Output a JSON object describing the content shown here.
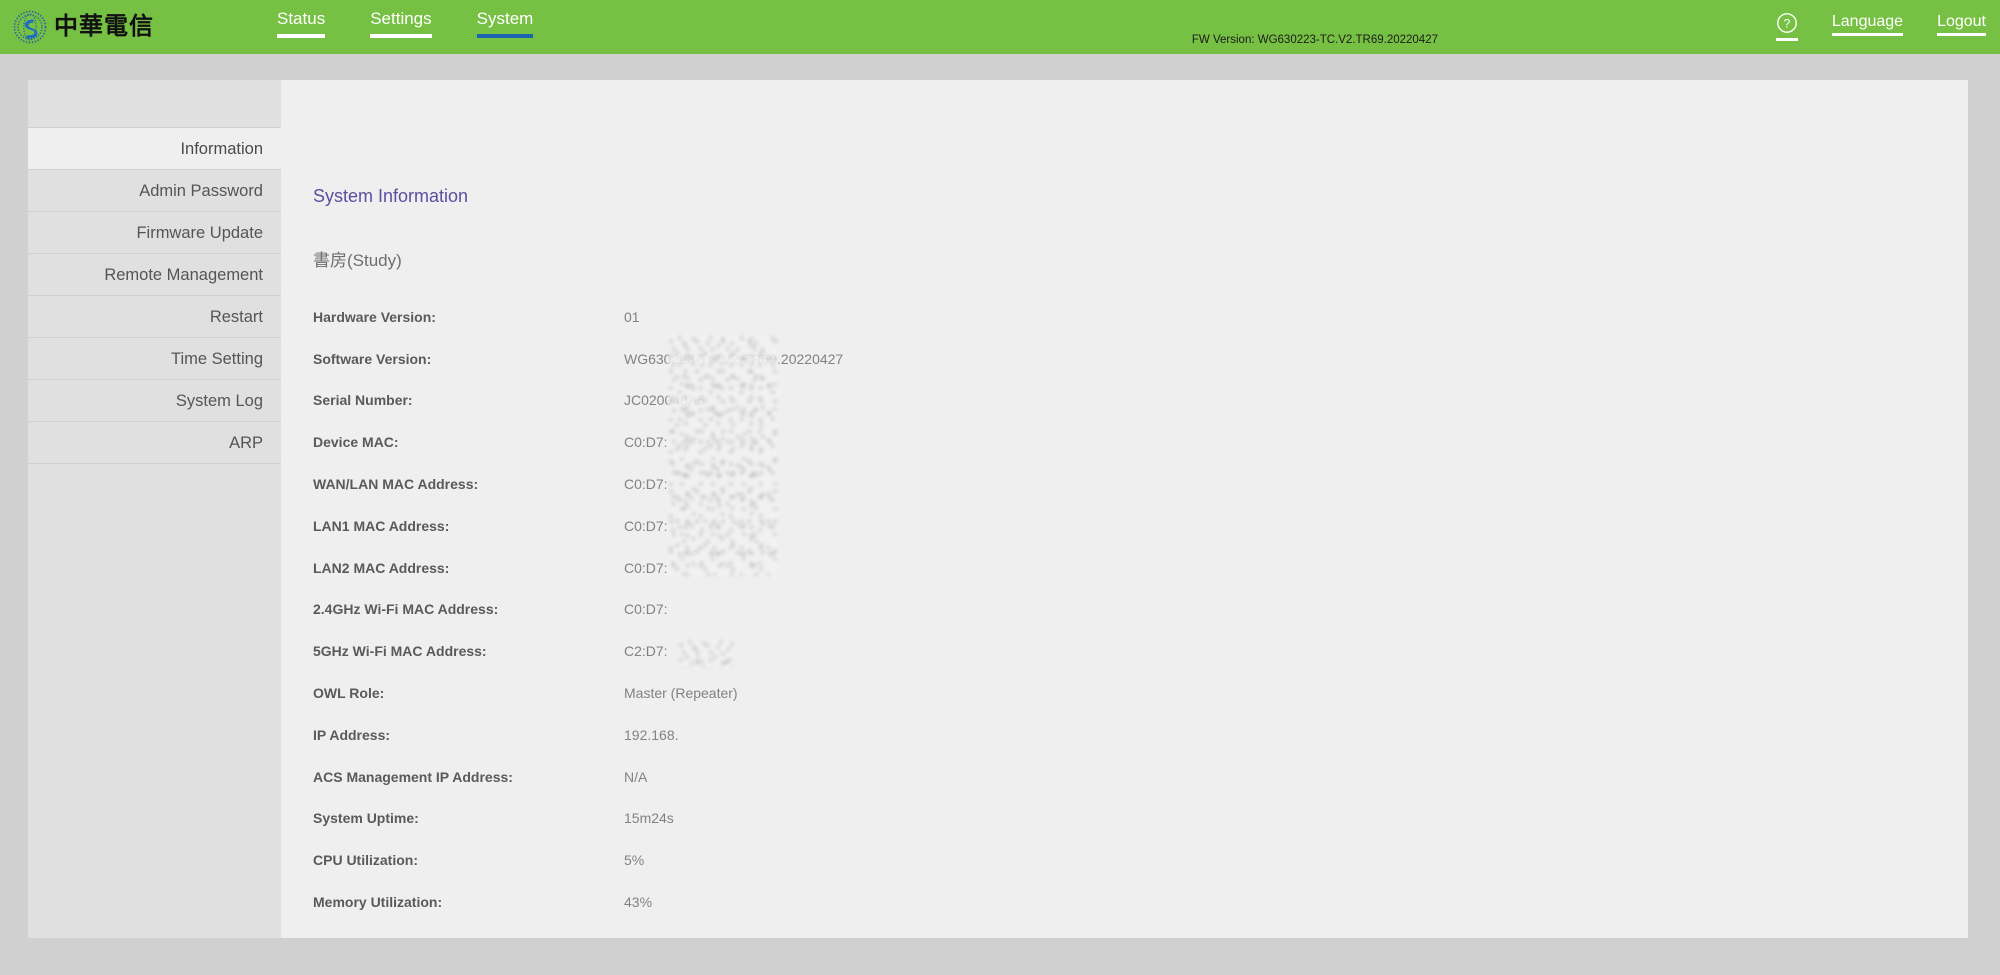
{
  "header": {
    "brand_name": "中華電信",
    "brand_logo_icon": "chunghwa-telecom-globe-logo",
    "nav_tabs": [
      {
        "label": "Status",
        "active": false
      },
      {
        "label": "Settings",
        "active": false
      },
      {
        "label": "System",
        "active": true
      }
    ],
    "fw_version": "FW Version: WG630223-TC.V2.TR69.20220427",
    "help_icon": "question-mark-circle-icon",
    "language_label": "Language",
    "logout_label": "Logout",
    "bar_color": "#76c043",
    "active_underline_color": "#1d64b0",
    "inactive_underline_color": "#ffffff"
  },
  "sidebar": {
    "items": [
      {
        "label": "Information",
        "active": true
      },
      {
        "label": "Admin Password",
        "active": false
      },
      {
        "label": "Firmware Update",
        "active": false
      },
      {
        "label": "Remote Management",
        "active": false
      },
      {
        "label": "Restart",
        "active": false
      },
      {
        "label": "Time Setting",
        "active": false
      },
      {
        "label": "System Log",
        "active": false
      },
      {
        "label": "ARP",
        "active": false
      }
    ]
  },
  "content": {
    "title": "System Information",
    "title_color": "#5b4e9e",
    "device_name": "書房(Study)",
    "rows": [
      {
        "label": "Hardware Version:",
        "value": "01"
      },
      {
        "label": "Software Version:",
        "value": "WG630223-TC.V2 TR69.20220427"
      },
      {
        "label": "Serial Number:",
        "value": "JC020048A6"
      },
      {
        "label": "Device MAC:",
        "value": "C0:D7:"
      },
      {
        "label": "WAN/LAN MAC Address:",
        "value": "C0:D7:"
      },
      {
        "label": "LAN1 MAC Address:",
        "value": "C0:D7:"
      },
      {
        "label": "LAN2 MAC Address:",
        "value": "C0:D7:"
      },
      {
        "label": "2.4GHz Wi-Fi MAC Address:",
        "value": "C0:D7:"
      },
      {
        "label": "5GHz Wi-Fi MAC Address:",
        "value": "C2:D7:"
      },
      {
        "label": "OWL Role:",
        "value": "Master (Repeater)"
      },
      {
        "label": "IP Address:",
        "value": "192.168."
      },
      {
        "label": "ACS Management IP Address:",
        "value": "N/A"
      },
      {
        "label": "System Uptime:",
        "value": "15m24s"
      },
      {
        "label": "CPU Utilization:",
        "value": "5%"
      },
      {
        "label": "Memory Utilization:",
        "value": "43%"
      }
    ]
  }
}
